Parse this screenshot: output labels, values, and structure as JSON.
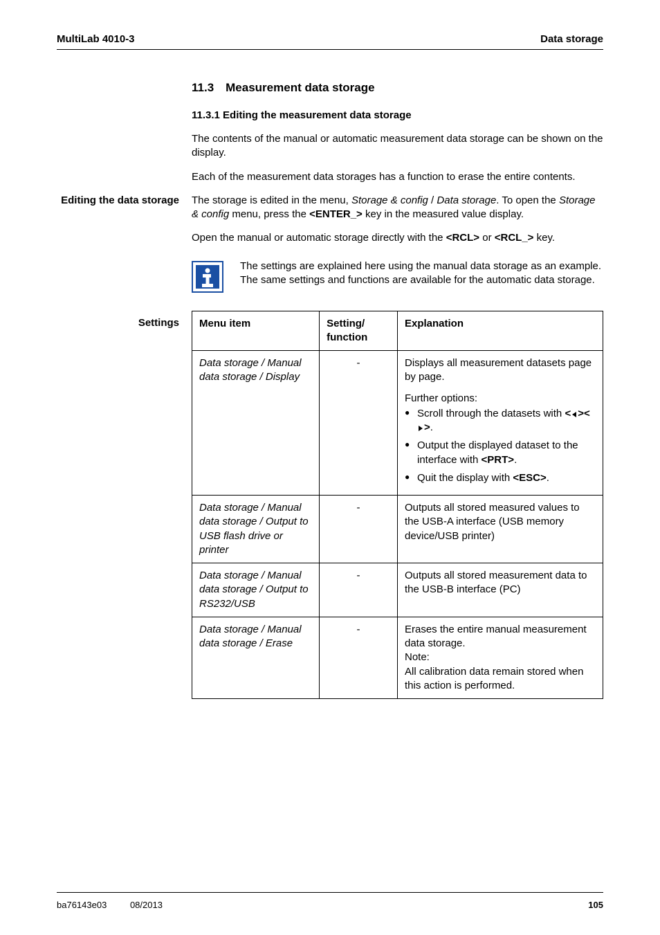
{
  "header": {
    "left": "MultiLab 4010-3",
    "right": "Data storage"
  },
  "section": {
    "num_title": "11.3 Measurement data storage",
    "sub_num_title": "11.3.1 Editing the measurement data storage",
    "intro1": "The contents of the manual or automatic measurement data storage can be shown on the display.",
    "intro2": "Each of the measurement data storages has a function to erase the entire contents."
  },
  "editing_label": "Editing the data storage",
  "editing": {
    "p1_a": "The storage is edited in the menu, ",
    "p1_i1": "Storage & config",
    "p1_b": " / ",
    "p1_i2": "Data storage",
    "p1_c": ". To open the ",
    "p1_i3": "Storage & config",
    "p1_d": " menu, press the ",
    "p1_key": "<ENTER_>",
    "p1_e": " key in the measured value display.",
    "p2_a": "Open the manual or automatic storage directly with the ",
    "p2_k1": "<RCL>",
    "p2_b": " or ",
    "p2_k2": "<RCL_>",
    "p2_c": " key."
  },
  "info_note": "The settings are explained here using the manual data storage as an example. The same settings and functions are available for the automatic data storage.",
  "settings_label": "Settings",
  "table": {
    "head": {
      "menu": "Menu item",
      "setting": "Setting/\nfunction",
      "expl": "Explanation"
    },
    "rows": [
      {
        "menu": "Data storage / Manual data storage / Display",
        "setting": "-",
        "expl_lead": "Displays all measurement datasets page by page.",
        "expl_sub": "Further options:",
        "bullets": [
          {
            "pre": "Scroll through the datasets with ",
            "key": "<◀><▶>",
            "post": "."
          },
          {
            "pre": "Output the displayed dataset to the interface with ",
            "key": "<PRT>",
            "post": "."
          },
          {
            "pre": "Quit the display with ",
            "key": "<ESC>",
            "post": "."
          }
        ]
      },
      {
        "menu": "Data storage / Manual data storage / Output to USB flash drive or printer",
        "setting": "-",
        "expl": "Outputs all stored measured values to the USB-A interface (USB memory device/USB printer)"
      },
      {
        "menu": "Data storage / Manual data storage / Output to RS232/USB",
        "setting": "-",
        "expl": "Outputs all stored measurement data to the USB-B interface (PC)"
      },
      {
        "menu": "Data storage / Manual data storage / Erase",
        "setting": "-",
        "expl": "Erases the entire manual measurement data storage.\nNote:\nAll calibration data remain stored when this action is performed."
      }
    ]
  },
  "footer": {
    "doc": "ba76143e03",
    "date": "08/2013",
    "page": "105"
  }
}
